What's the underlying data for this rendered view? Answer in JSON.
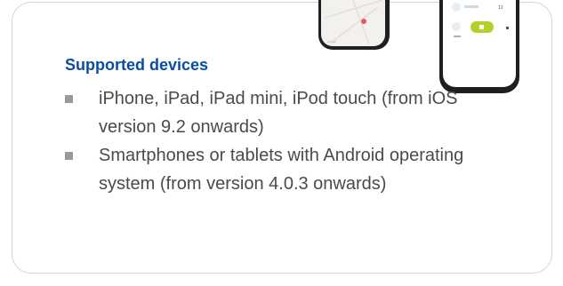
{
  "section": {
    "title": "Supported devices",
    "items": [
      {
        "text": "iPhone, iPad, iPad mini, iPod touch (from iOS version 9.2 onwards)"
      },
      {
        "text": "Smartphones or tablets with Android operating system (from version 4.0.3 onwards)"
      }
    ]
  },
  "colors": {
    "title": "#0a4ea3",
    "card_border": "#c9d6e6",
    "body_text": "#4a4a4a",
    "bullet": "#9a9a9a",
    "accent_green": "#b6cf2a"
  }
}
